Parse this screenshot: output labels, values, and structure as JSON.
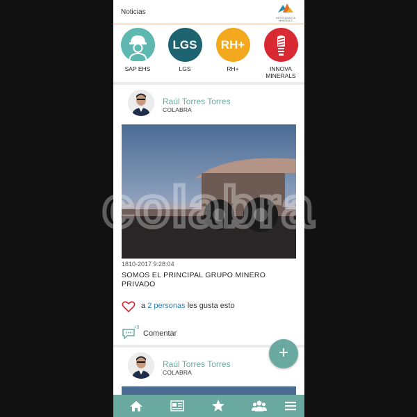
{
  "header": {
    "title": "Noticias",
    "logo_text": [
      "ANTOFAGASTA",
      "MINERALS"
    ]
  },
  "apps": [
    {
      "label": "SAP EHS",
      "icon": "worker-helmet-icon",
      "color": "#5fb8b0"
    },
    {
      "label": "LGS",
      "circle_text": "LGS",
      "color": "#1d6470"
    },
    {
      "label": "RH+",
      "circle_text": "RH+",
      "color": "#f3a81d"
    },
    {
      "label": "INNOVA MINERALS",
      "icon": "lightbulb-icon",
      "color": "#d82a33"
    }
  ],
  "posts": [
    {
      "author": "Raúl Torres Torres",
      "org": "COLABRA",
      "image": "mining-haul-truck-photo",
      "date": "1810-2017 9:28:04",
      "headline": "SOMOS EL PRINCIPAL GRUPO MINERO PRIVADO",
      "likes_prefix": "a",
      "likes_count": "2 personas",
      "likes_suffix": "les gusta esto",
      "comment_badge": "+9",
      "comment_label": "Comentar"
    },
    {
      "author": "Raúl Torres Torres",
      "org": "COLABRA"
    }
  ],
  "fab_label": "+",
  "bottom_nav": [
    "home-icon",
    "news-icon",
    "star-icon",
    "users-icon",
    "menu-icon"
  ],
  "watermark": "colabra",
  "colors": {
    "accent": "#6aa9a0",
    "link": "#2b7fb3",
    "like": "#d0282f"
  }
}
